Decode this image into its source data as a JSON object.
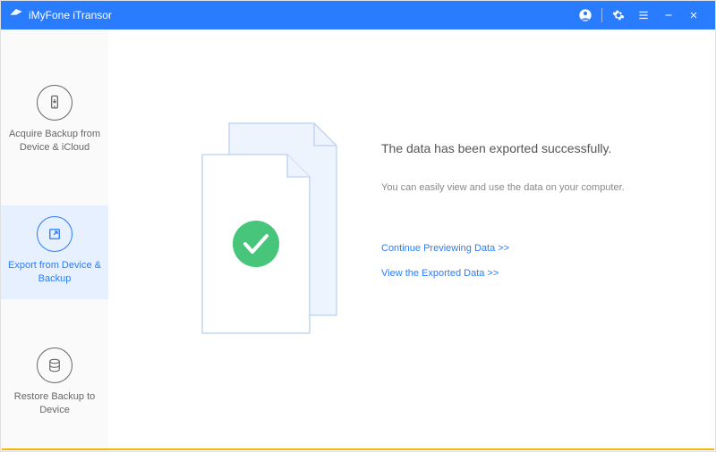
{
  "titlebar": {
    "app_name": "iMyFone iTransor"
  },
  "sidebar": {
    "items": [
      {
        "label": "Acquire Backup from Device & iCloud"
      },
      {
        "label": "Export from Device & Backup"
      },
      {
        "label": "Restore Backup to Device"
      }
    ]
  },
  "main": {
    "heading": "The data has been exported successfully.",
    "subtext": "You can easily view and use the data on your computer.",
    "link_continue": "Continue Previewing Data >>",
    "link_view": "View the Exported Data >>"
  },
  "colors": {
    "primary": "#2a7cff",
    "success": "#47c57a",
    "page_stroke": "#b9d0f2",
    "accent_footer": "#f2b705"
  }
}
